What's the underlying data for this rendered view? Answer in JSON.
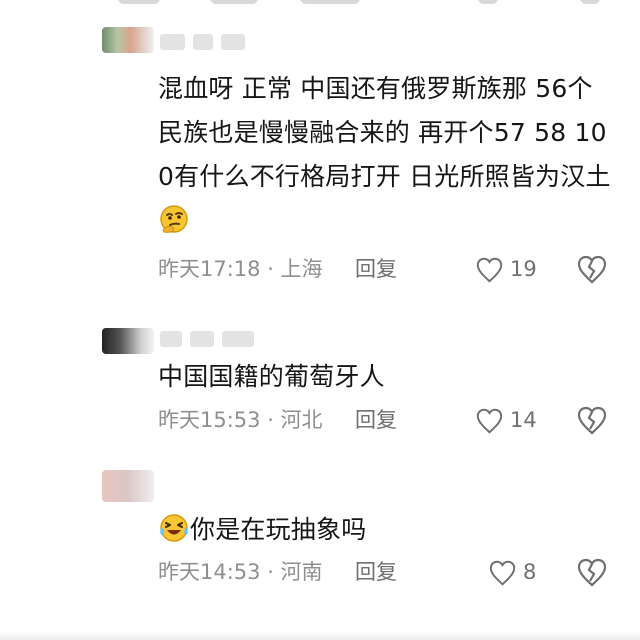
{
  "comments": [
    {
      "text": "混血呀 正常 中国还有俄罗斯族那 56个民族也是慢慢融合来的 再开个57 58 100有什么不行格局打开 日光所照皆为汉土",
      "emoji": "thinking-face-icon",
      "meta": "昨天17:18 · 上海",
      "reply_label": "回复",
      "likes": "19"
    },
    {
      "text": "中国国籍的葡萄牙人",
      "meta": "昨天15:53 · 河北",
      "reply_label": "回复",
      "likes": "14"
    },
    {
      "text": "你是在玩抽象吗",
      "emoji": "laughing-crying-face-icon",
      "meta": "昨天14:53 · 河南",
      "reply_label": "回复",
      "likes": "8"
    }
  ],
  "colors": {
    "text": "#161616",
    "meta": "#8f8f8f",
    "action": "#6f6f6f",
    "background": "#ffffff"
  }
}
